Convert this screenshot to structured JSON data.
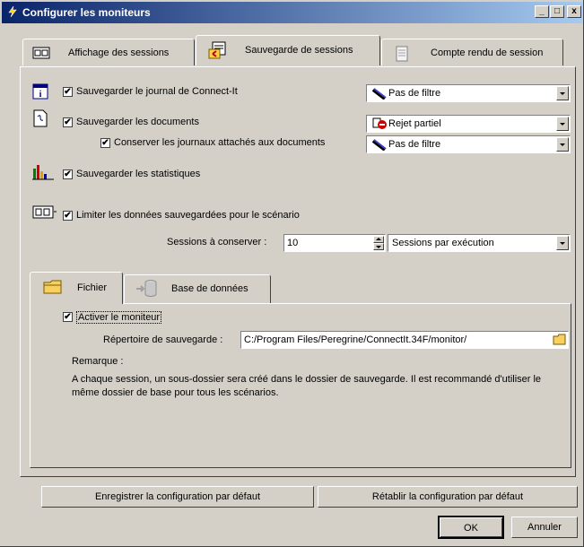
{
  "window": {
    "title": "Configurer les moniteurs",
    "controls": {
      "minimize": "_",
      "maximize": "□",
      "close": "x"
    }
  },
  "tabs": [
    {
      "label": "Affichage des sessions",
      "icon": "display-icon"
    },
    {
      "label": "Sauvegarde de sessions",
      "icon": "save-sessions-icon"
    },
    {
      "label": "Compte rendu de session",
      "icon": "report-icon"
    }
  ],
  "options": {
    "journal": {
      "label": "Sauvegarder le journal de Connect-It",
      "checked": true,
      "filter": "Pas de filtre"
    },
    "documents": {
      "label": "Sauvegarder les documents",
      "checked": true,
      "filter": "Rejet partiel"
    },
    "attached_logs": {
      "label": "Conserver les journaux attachés aux documents",
      "checked": true,
      "filter": "Pas de filtre"
    },
    "stats": {
      "label": "Sauvegarder les statistiques",
      "checked": true
    },
    "limit": {
      "label": "Limiter les données sauvegardées pour le scénario",
      "checked": true
    }
  },
  "sessions": {
    "label": "Sessions à conserver :",
    "value": "10",
    "unit": "Sessions par exécution"
  },
  "subtabs": [
    {
      "label": "Fichier",
      "icon": "folder-icon"
    },
    {
      "label": "Base de données",
      "icon": "database-icon"
    }
  ],
  "fichier": {
    "enable_label": "Activer le moniteur",
    "enable_checked": true,
    "dir_label": "Répertoire de sauvegarde :",
    "dir_value": "C:/Program Files/Peregrine/ConnectIt.34F/monitor/",
    "remark_label": "Remarque :",
    "remark_text": "A chaque session, un sous-dossier sera créé dans le dossier de sauvegarde. Il est recommandé d'utiliser le même dossier de base pour tous les scénarios."
  },
  "footer": {
    "save_default": "Enregistrer la configuration par défaut",
    "restore_default": "Rétablir la configuration par défaut",
    "ok": "OK",
    "cancel": "Annuler"
  },
  "colors": {
    "titlebar_start": "#0a246a",
    "titlebar_end": "#a6caf0",
    "face": "#d4d0c8"
  }
}
